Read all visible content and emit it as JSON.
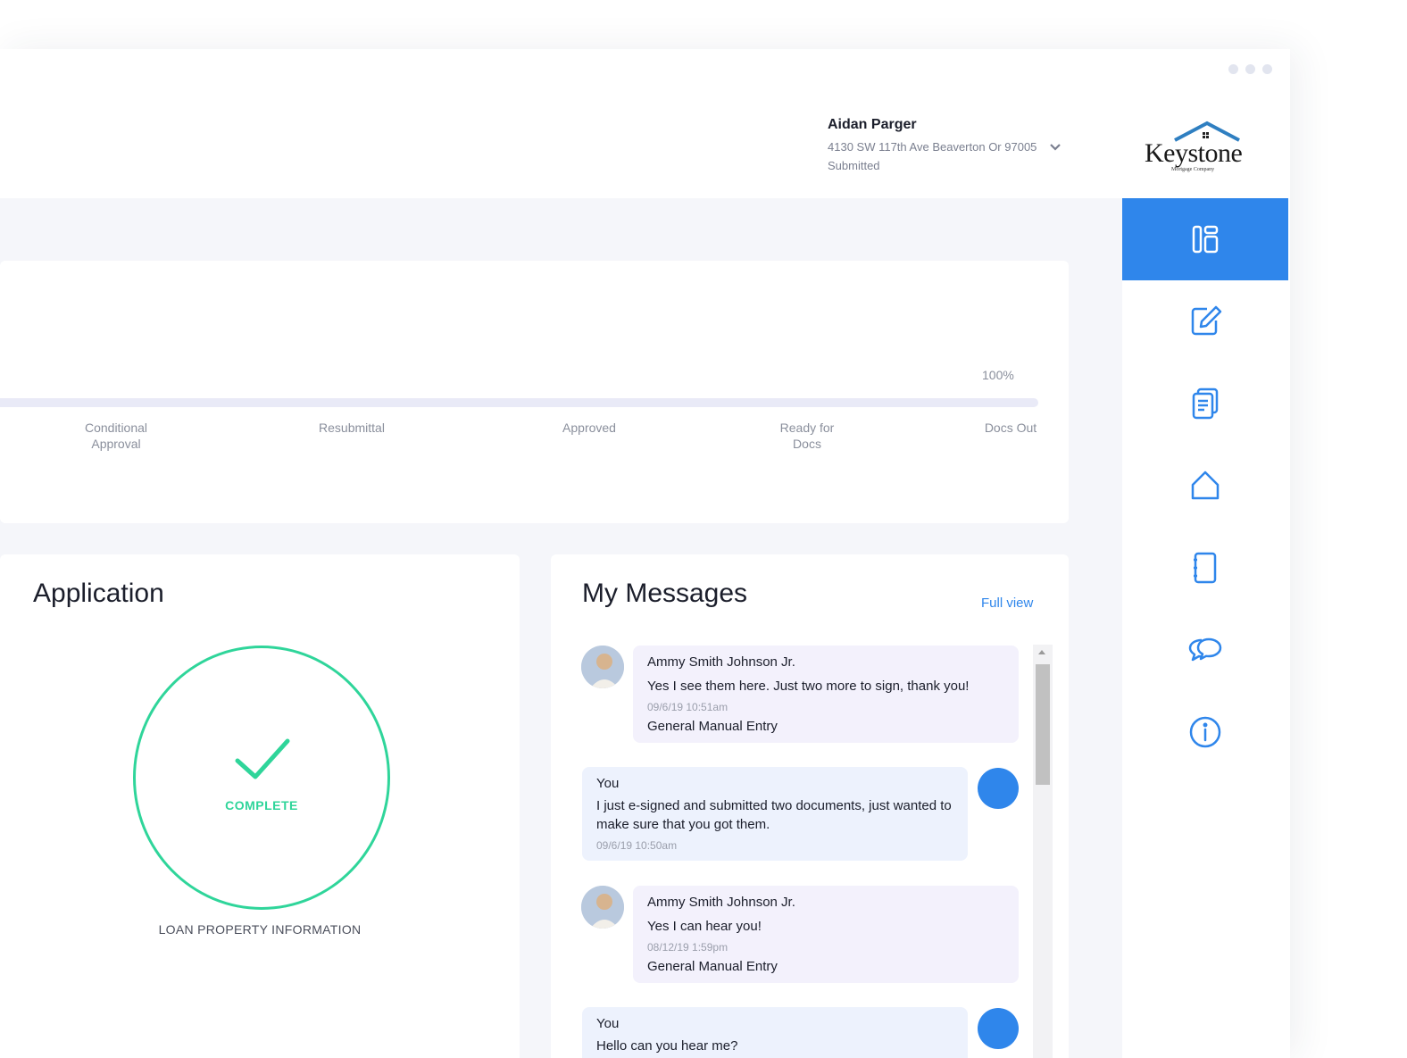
{
  "header": {
    "borrower_name": "Aidan Parger",
    "address": "4130 SW 117th Ave Beaverton Or 97005",
    "status": "Submitted"
  },
  "logo": {
    "text": "Keystone",
    "subtext": "Mortgage Company"
  },
  "progress": {
    "percent_label": "100%",
    "stages": [
      {
        "label": "Conditional Approval"
      },
      {
        "label": "Resubmittal"
      },
      {
        "label": "Approved"
      },
      {
        "label": "Ready for Docs"
      },
      {
        "label": "Docs Out"
      }
    ]
  },
  "application": {
    "title": "Application",
    "status": "COMPLETE",
    "section_label": "LOAN PROPERTY INFORMATION"
  },
  "messages": {
    "title": "My Messages",
    "full_view_label": "Full view",
    "items": [
      {
        "sender": "Ammy Smith Johnson Jr.",
        "text": "Yes I see them here. Just two more to sign, thank you!",
        "time": "09/6/19 10:51am",
        "tag": "General Manual Entry"
      },
      {
        "sender": "You",
        "text": "I just e-signed and submitted two documents, just wanted to make sure that you got them.",
        "time": "09/6/19 10:50am"
      },
      {
        "sender": "Ammy Smith Johnson Jr.",
        "text": "Yes I can hear you!",
        "time": "08/12/19 1:59pm",
        "tag": "General Manual Entry"
      },
      {
        "sender": "You",
        "text": "Hello can you hear me?"
      }
    ]
  },
  "nav": {
    "items": [
      {
        "icon": "dashboard-icon",
        "active": true
      },
      {
        "icon": "edit-icon"
      },
      {
        "icon": "documents-icon"
      },
      {
        "icon": "home-icon"
      },
      {
        "icon": "notebook-icon"
      },
      {
        "icon": "chat-icon"
      },
      {
        "icon": "info-icon"
      }
    ]
  },
  "colors": {
    "accent": "#2f86eb",
    "success": "#2fd59a",
    "background": "#f5f6fa"
  }
}
